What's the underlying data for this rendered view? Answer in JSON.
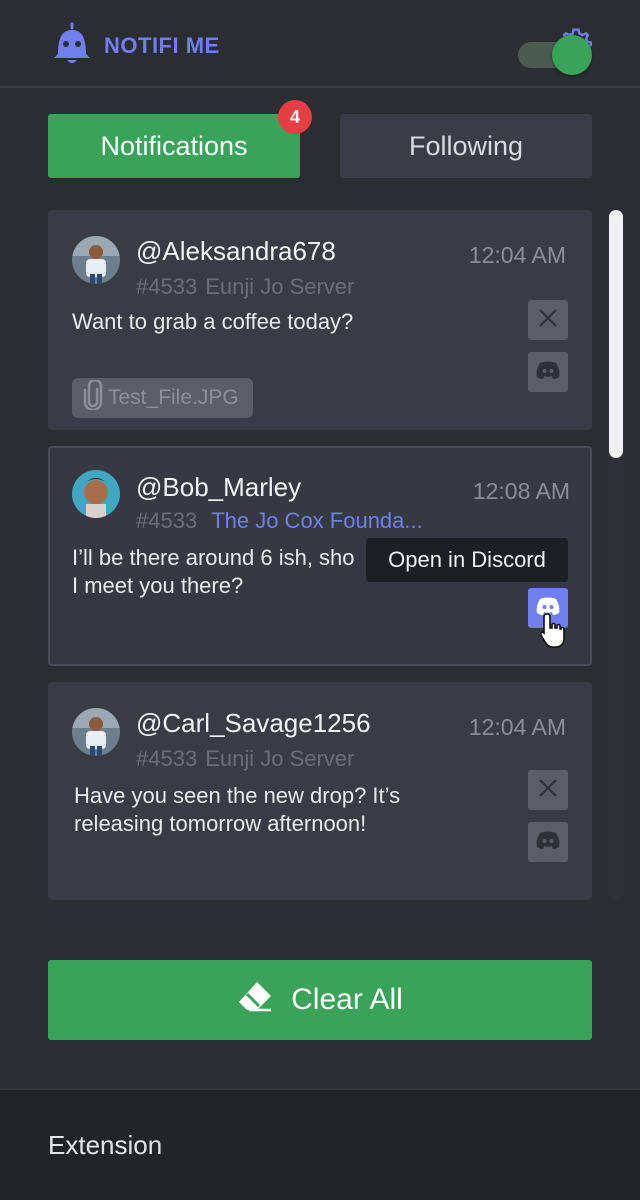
{
  "app": {
    "title": "NOTIFI ME"
  },
  "header": {
    "settings_icon": "gear-icon",
    "logo_icon": "bell-ghost-icon"
  },
  "tabs": [
    {
      "label": "Notifications",
      "active": true,
      "badge": "4"
    },
    {
      "label": "Following",
      "active": false
    }
  ],
  "notifications": [
    {
      "username": "@Aleksandra678",
      "time": "12:04 AM",
      "tag": "#4533",
      "server": "Eunji Jo Server",
      "message": "Want to grab a coffee today?",
      "attachment": "Test_File.JPG"
    },
    {
      "username": "@Bob_Marley",
      "time": "12:08 AM",
      "tag": "#4533",
      "server": "The Jo Cox Founda...",
      "message_line1": "I’ll be there around 6 ish, sho",
      "message_line2": "I meet you there?"
    },
    {
      "username": "@Carl_Savage1256",
      "time": "12:04 AM",
      "tag": "#4533",
      "server": "Eunji Jo Server",
      "message": "Have you seen the new drop? It’s releasing tomorrow afternoon!"
    }
  ],
  "tooltip": {
    "text": "Open in Discord"
  },
  "actions": {
    "clear_all_label": "Clear All"
  },
  "footer": {
    "label": "Extension",
    "toggle_on": true
  },
  "colors": {
    "accent_green": "#3aa35a",
    "brand_blue": "#6f7ff0",
    "badge_red": "#e53e43",
    "background": "#2b2d33"
  }
}
